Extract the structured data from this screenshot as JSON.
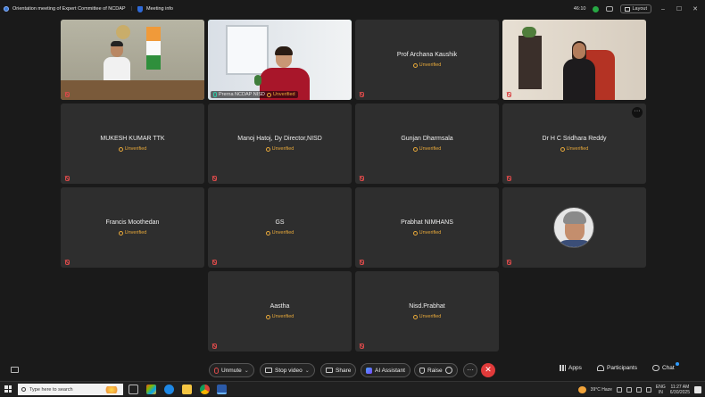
{
  "titlebar": {
    "meeting_title": "Orientation meeting of Expert Committee of NCDAP",
    "meeting_info": "Meeting info",
    "timer": "46:10",
    "layout_label": "Layout"
  },
  "tiles": [
    {
      "name": "",
      "status": "",
      "type": "video-official"
    },
    {
      "name": "Prerna NCDAP NISD",
      "status": "Unverified",
      "type": "video-speaker"
    },
    {
      "name": "Prof Archana Kaushik",
      "status": "Unverified",
      "type": "name"
    },
    {
      "name": "",
      "status": "",
      "type": "video-woman"
    },
    {
      "name": "MUKESH KUMAR TTK",
      "status": "Unverified",
      "type": "name"
    },
    {
      "name": "Manoj Hatoj, Dy Director,NISD",
      "status": "Unverified",
      "type": "name"
    },
    {
      "name": "Gunjan Dharmsala",
      "status": "Unverified",
      "type": "name"
    },
    {
      "name": "Dr H C Sridhara Reddy",
      "status": "Unverified",
      "type": "name"
    },
    {
      "name": "Francis Moothedan",
      "status": "Unverified",
      "type": "name"
    },
    {
      "name": "GS",
      "status": "Unverified",
      "type": "name"
    },
    {
      "name": "Prabhat NIMHANS",
      "status": "Unverified",
      "type": "name"
    },
    {
      "name": "",
      "status": "",
      "type": "avatar"
    },
    {
      "name": "Aastha",
      "status": "Unverified",
      "type": "name"
    },
    {
      "name": "Nisd.Prabhat",
      "status": "Unverified",
      "type": "name"
    }
  ],
  "toolbar": {
    "unmute": "Unmute",
    "stop_video": "Stop video",
    "share": "Share",
    "ai_assistant": "AI Assistant",
    "raise": "Raise",
    "more": "···",
    "end": "✕",
    "apps": "Apps",
    "participants": "Participants",
    "chat": "Chat"
  },
  "taskbar": {
    "search_placeholder": "Type here to search",
    "weather": "39°C  Haze",
    "lang1": "ENG",
    "lang2": "IN",
    "time": "11:27 AM",
    "date": "6/30/2025"
  },
  "colors": {
    "accent_green": "#2fc9a6",
    "unverified": "#e8a93a",
    "end_red": "#e03a3a"
  }
}
